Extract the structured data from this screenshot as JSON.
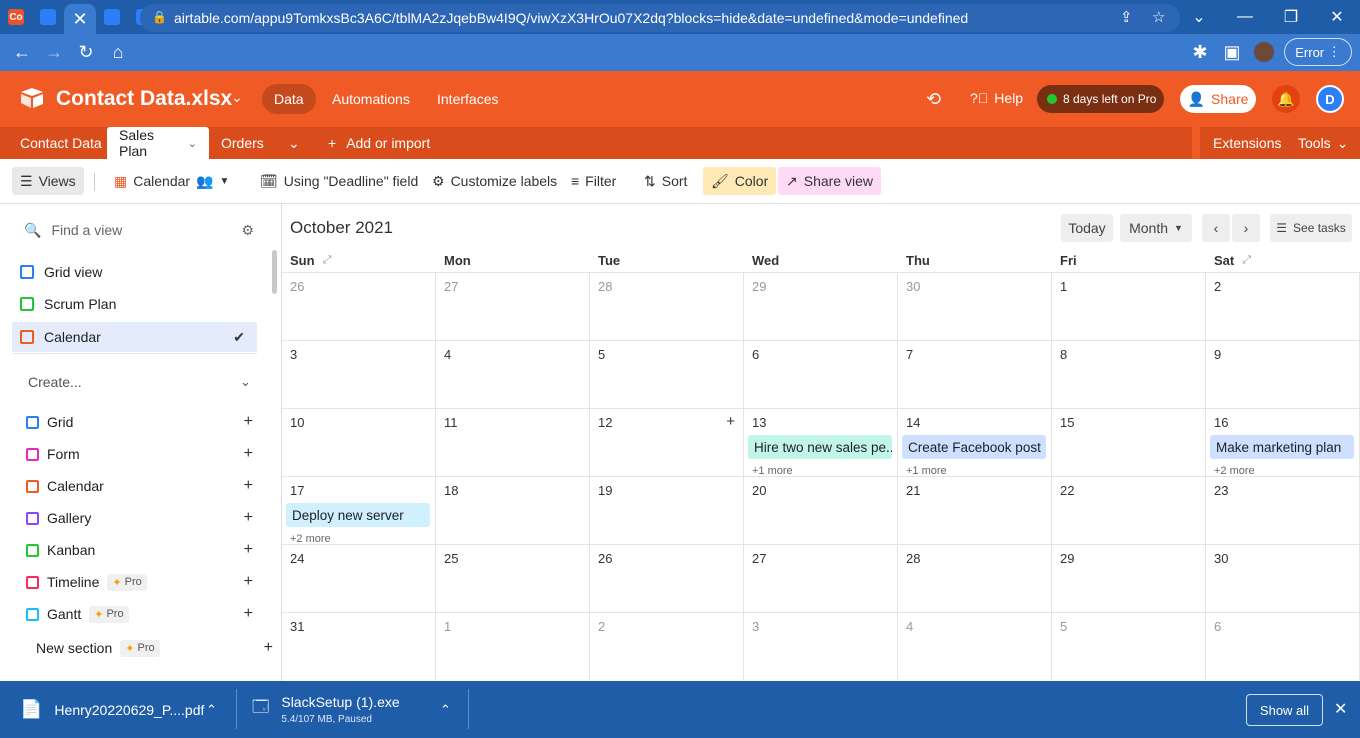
{
  "browser": {
    "url": "airtable.com/appu9TomkxsBc3A6C/tblMA2zJqebBw4I9Q/viwXzX3HrOu07X2dq?blocks=hide&date=undefined&mode=undefined",
    "error_label": "Error",
    "tab_favicons": [
      "Co",
      "",
      "",
      "",
      "",
      "",
      "",
      "",
      "",
      "",
      "a",
      "",
      "",
      "M",
      "",
      "",
      "",
      "",
      "",
      "",
      "",
      "",
      "",
      "",
      "",
      "",
      "",
      "",
      "",
      "",
      "",
      ""
    ]
  },
  "app": {
    "base_name": "Contact Data.xlsx",
    "nav": [
      "Data",
      "Automations",
      "Interfaces"
    ],
    "help_label": "Help",
    "pro_badge": "8 days left on Pro",
    "share_label": "Share",
    "avatar_letter": "D",
    "brand_color": "#f05a24"
  },
  "tables": {
    "items": [
      "Contact Data",
      "Sales Plan",
      "Orders"
    ],
    "add_label": "Add or import",
    "extensions_label": "Extensions",
    "tools_label": "Tools"
  },
  "viewbar": {
    "views_label": "Views",
    "view_name": "Calendar",
    "field_label": "Using \"Deadline\" field",
    "customize_label": "Customize labels",
    "filter_label": "Filter",
    "sort_label": "Sort",
    "color_label": "Color",
    "share_view_label": "Share view"
  },
  "sidebar": {
    "find_placeholder": "Find a view",
    "views": [
      {
        "label": "Grid view",
        "color": "#2d7ff9"
      },
      {
        "label": "Scrum Plan",
        "color": "#20c933"
      },
      {
        "label": "Calendar",
        "color": "#f05a24"
      }
    ],
    "create_label": "Create...",
    "create_items": [
      {
        "label": "Grid",
        "color": "#2d7ff9",
        "pro": ""
      },
      {
        "label": "Form",
        "color": "#e929ba",
        "pro": ""
      },
      {
        "label": "Calendar",
        "color": "#f05a24",
        "pro": ""
      },
      {
        "label": "Gallery",
        "color": "#8b46ff",
        "pro": ""
      },
      {
        "label": "Kanban",
        "color": "#20c933",
        "pro": ""
      },
      {
        "label": "Timeline",
        "color": "#f82b60",
        "pro": "Pro"
      },
      {
        "label": "Gantt",
        "color": "#18bfff",
        "pro": "Pro"
      }
    ],
    "new_section_label": "New section",
    "new_section_pro": "Pro"
  },
  "calendar": {
    "month_label": "October 2021",
    "today_label": "Today",
    "mode_label": "Month",
    "see_tasks_label": "See tasks",
    "weekdays": [
      "Sun",
      "Mon",
      "Tue",
      "Wed",
      "Thu",
      "Fri",
      "Sat"
    ],
    "weeks": [
      [
        {
          "d": "26",
          "m": true
        },
        {
          "d": "27",
          "m": true
        },
        {
          "d": "28",
          "m": true
        },
        {
          "d": "29",
          "m": true
        },
        {
          "d": "30",
          "m": true
        },
        {
          "d": "1"
        },
        {
          "d": "2"
        }
      ],
      [
        {
          "d": "3"
        },
        {
          "d": "4"
        },
        {
          "d": "5"
        },
        {
          "d": "6"
        },
        {
          "d": "7"
        },
        {
          "d": "8"
        },
        {
          "d": "9"
        }
      ],
      [
        {
          "d": "10"
        },
        {
          "d": "11"
        },
        {
          "d": "12",
          "plus": true
        },
        {
          "d": "13",
          "event": "Hire two new sales pe...",
          "color": "#c2f5e9",
          "more": "+1 more"
        },
        {
          "d": "14",
          "event": "Create Facebook post",
          "color": "#cfdfff",
          "more": "+1 more"
        },
        {
          "d": "15"
        },
        {
          "d": "16",
          "event": "Make marketing plan",
          "color": "#cfdfff",
          "more": "+2 more"
        }
      ],
      [
        {
          "d": "17",
          "event": "Deploy new server",
          "color": "#d0f0fd",
          "more": "+2 more"
        },
        {
          "d": "18"
        },
        {
          "d": "19"
        },
        {
          "d": "20"
        },
        {
          "d": "21"
        },
        {
          "d": "22"
        },
        {
          "d": "23"
        }
      ],
      [
        {
          "d": "24"
        },
        {
          "d": "25"
        },
        {
          "d": "26"
        },
        {
          "d": "27"
        },
        {
          "d": "28"
        },
        {
          "d": "29"
        },
        {
          "d": "30"
        }
      ],
      [
        {
          "d": "31"
        },
        {
          "d": "1",
          "m": true
        },
        {
          "d": "2",
          "m": true
        },
        {
          "d": "3",
          "m": true
        },
        {
          "d": "4",
          "m": true
        },
        {
          "d": "5",
          "m": true
        },
        {
          "d": "6",
          "m": true
        }
      ]
    ]
  },
  "downloads": {
    "items": [
      {
        "name": "Henry20220629_P....pdf",
        "status": ""
      },
      {
        "name": "SlackSetup (1).exe",
        "status": "5.4/107 MB, Paused"
      }
    ],
    "show_all_label": "Show all"
  }
}
